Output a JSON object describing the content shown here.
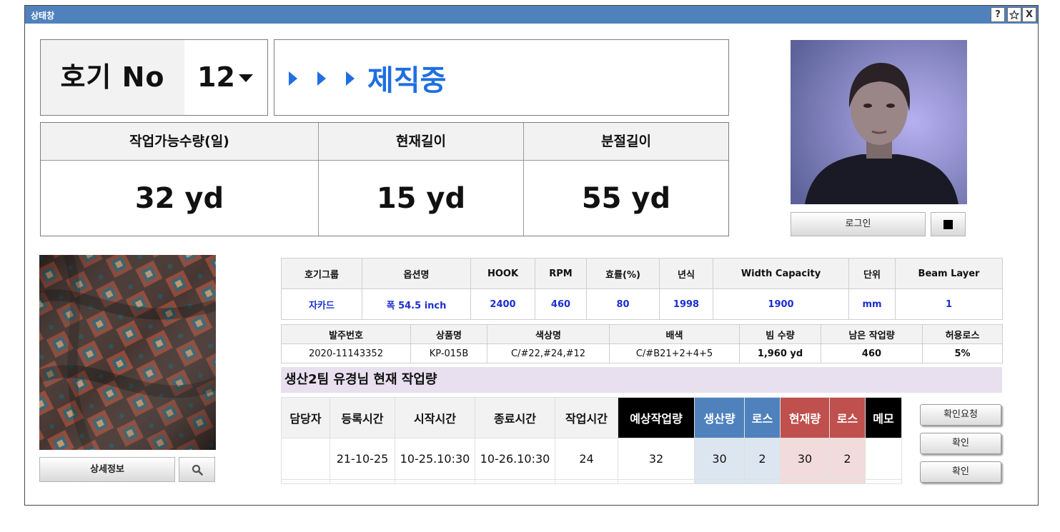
{
  "window": {
    "title": "상태창",
    "help_label": "?",
    "close_label": "X"
  },
  "header": {
    "hogi_label": "호기 No",
    "hogi_value": "12",
    "status_text": "제직중"
  },
  "metrics": [
    {
      "label": "작업가능수량(일)",
      "value": "32 yd"
    },
    {
      "label": "현재길이",
      "value": "15 yd"
    },
    {
      "label": "분절길이",
      "value": "55 yd"
    }
  ],
  "profile": {
    "login_label": "로그인"
  },
  "fabric": {
    "detail_label": "상세정보"
  },
  "spec": {
    "headers": [
      "호기그룹",
      "옵션명",
      "HOOK",
      "RPM",
      "효률(%)",
      "년식",
      "Width Capacity",
      "단위",
      "Beam Layer"
    ],
    "values": [
      "자카드",
      "폭 54.5 inch",
      "2400",
      "460",
      "80",
      "1998",
      "1900",
      "mm",
      "1"
    ]
  },
  "order": {
    "headers": [
      "발주번호",
      "상품명",
      "색상명",
      "배색",
      "빔 수량",
      "남은 작업량",
      "허용로스"
    ],
    "values": [
      "2020-11143352",
      "KP-015B",
      "C/#22,#24,#12",
      "C/#B21+2+4+5",
      "1,960 yd",
      "460",
      "5%"
    ]
  },
  "team": {
    "title": "생산2팀 유경님 현재 작업량"
  },
  "work": {
    "headers": [
      "담당자",
      "등록시간",
      "시작시간",
      "종료시간",
      "작업시간",
      "예상작업량",
      "생산량",
      "로스",
      "현재량",
      "로스",
      "메모"
    ],
    "row": [
      "",
      "21-10-25",
      "10-25.10:30",
      "10-26.10:30",
      "24",
      "32",
      "30",
      "2",
      "30",
      "2",
      ""
    ]
  },
  "actions": {
    "confirm_request": "확인요청",
    "confirm1": "확인",
    "confirm2": "확인"
  },
  "colors": {
    "titlebar": "#4f81bd",
    "status_blue": "#1f6fe0",
    "produce_blue": "#4f81bd",
    "current_red": "#c0504d"
  }
}
